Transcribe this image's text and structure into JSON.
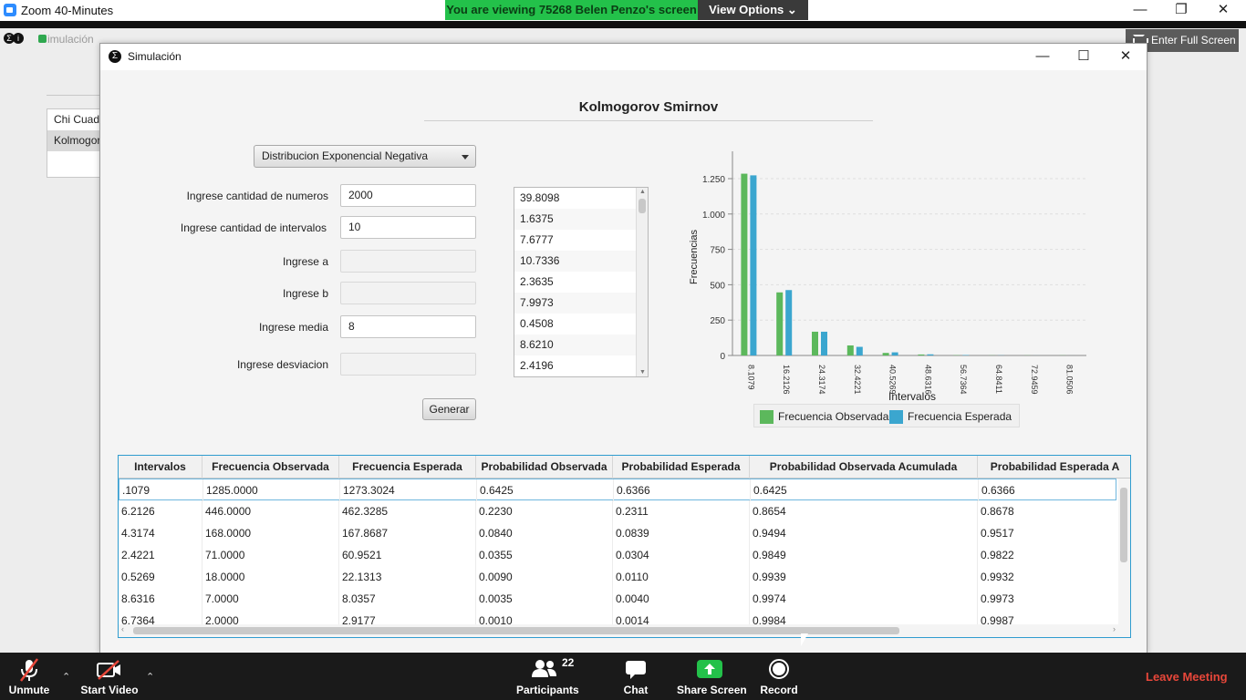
{
  "zoom": {
    "title": "Zoom 40-Minutes",
    "banner": "You are viewing 75268 Belen Penzo's screen",
    "view_options": "View Options",
    "enter_full_screen": "Enter Full Screen"
  },
  "background_app": {
    "title": "imulación",
    "list": [
      "Chi Cuadrado",
      "Kolmogorov"
    ]
  },
  "window": {
    "title": "Simulación"
  },
  "form": {
    "heading": "Kolmogorov Smirnov",
    "distribution": "Distribucion Exponencial Negativa",
    "labels": {
      "cantidad_numeros": "Ingrese cantidad de numeros",
      "cantidad_intervalos": "Ingrese cantidad de intervalos",
      "a": "Ingrese a",
      "b": "Ingrese b",
      "media": "Ingrese media",
      "desviacion": "Ingrese desviacion"
    },
    "values": {
      "cantidad_numeros": "2000",
      "cantidad_intervalos": "10",
      "a": "",
      "b": "",
      "media": "8",
      "desviacion": ""
    },
    "generar": "Generar"
  },
  "numbers": [
    "39.8098",
    "1.6375",
    "7.6777",
    "10.7336",
    "2.3635",
    "7.9973",
    "0.4508",
    "8.6210",
    "2.4196"
  ],
  "chart_data": {
    "type": "bar",
    "ylabel": "Frecuencias",
    "xlabel": "Intervalos",
    "categories": [
      "8.1079",
      "16.2126",
      "24.3174",
      "32.4221",
      "40.5269",
      "48.6316",
      "56.7364",
      "64.8411",
      "72.9459",
      "81.0506"
    ],
    "ylim": [
      0,
      1250
    ],
    "yticks": [
      "0",
      "250",
      "500",
      "750",
      "1.000",
      "1.250"
    ],
    "series": [
      {
        "name": "Frecuencia Observada",
        "color": "#5cb85c",
        "values": [
          1285,
          446,
          168,
          71,
          18,
          7,
          2,
          1,
          1,
          1
        ]
      },
      {
        "name": "Frecuencia Esperada",
        "color": "#3ba6cf",
        "values": [
          1273.3024,
          462.3285,
          167.8687,
          60.9521,
          22.1313,
          8.0357,
          2.9177,
          1.0594,
          0.3847,
          0.1397
        ]
      }
    ],
    "legend": "bottom",
    "grid": true
  },
  "table": {
    "headers": [
      "Intervalos",
      "Frecuencia Observada",
      "Frecuencia Esperada",
      "Probabilidad Observada",
      "Probabilidad Esperada",
      "Probabilidad Observada Acumulada",
      "Probabilidad Esperada A"
    ],
    "rows": [
      [
        ".1079",
        "1285.0000",
        "1273.3024",
        "0.6425",
        "0.6366",
        "0.6425",
        "0.6366"
      ],
      [
        "6.2126",
        "446.0000",
        "462.3285",
        "0.2230",
        "0.2311",
        "0.8654",
        "0.8678"
      ],
      [
        "4.3174",
        "168.0000",
        "167.8687",
        "0.0840",
        "0.0839",
        "0.9494",
        "0.9517"
      ],
      [
        "2.4221",
        "71.0000",
        "60.9521",
        "0.0355",
        "0.0304",
        "0.9849",
        "0.9822"
      ],
      [
        "0.5269",
        "18.0000",
        "22.1313",
        "0.0090",
        "0.0110",
        "0.9939",
        "0.9932"
      ],
      [
        "8.6316",
        "7.0000",
        "8.0357",
        "0.0035",
        "0.0040",
        "0.9974",
        "0.9973"
      ],
      [
        "6.7364",
        "2.0000",
        "2.9177",
        "0.0010",
        "0.0014",
        "0.9984",
        "0.9987"
      ]
    ]
  },
  "toolbar": {
    "unmute": "Unmute",
    "start_video": "Start Video",
    "participants": "Participants",
    "participants_count": "22",
    "chat": "Chat",
    "share_screen": "Share Screen",
    "record": "Record",
    "leave": "Leave Meeting"
  }
}
